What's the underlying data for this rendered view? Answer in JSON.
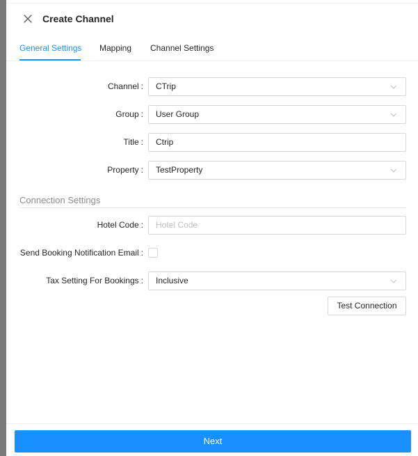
{
  "drawer": {
    "title": "Create Channel"
  },
  "tabs": [
    {
      "label": "General Settings",
      "active": true
    },
    {
      "label": "Mapping",
      "active": false
    },
    {
      "label": "Channel Settings",
      "active": false
    }
  ],
  "form": {
    "channel": {
      "label": "Channel",
      "value": "CTrip",
      "icon": "chevron-down-icon"
    },
    "group": {
      "label": "Group",
      "value": "User Group",
      "icon": "chevron-down-icon"
    },
    "title": {
      "label": "Title",
      "value": "Ctrip"
    },
    "property": {
      "label": "Property",
      "value": "TestProperty",
      "icon": "chevron-down-icon"
    }
  },
  "connection": {
    "section_title": "Connection Settings",
    "hotel_code": {
      "label": "Hotel Code",
      "value": "",
      "placeholder": "Hotel Code"
    },
    "send_email": {
      "label": "Send Booking Notification Email",
      "checked": false
    },
    "tax_setting": {
      "label": "Tax Setting For Bookings",
      "value": "Inclusive",
      "icon": "chevron-down-icon"
    },
    "test_button": "Test Connection"
  },
  "footer": {
    "next_label": "Next"
  },
  "colors": {
    "accent": "#1890ff",
    "border": "#d9d9d9",
    "placeholder": "#bfbfbf"
  }
}
